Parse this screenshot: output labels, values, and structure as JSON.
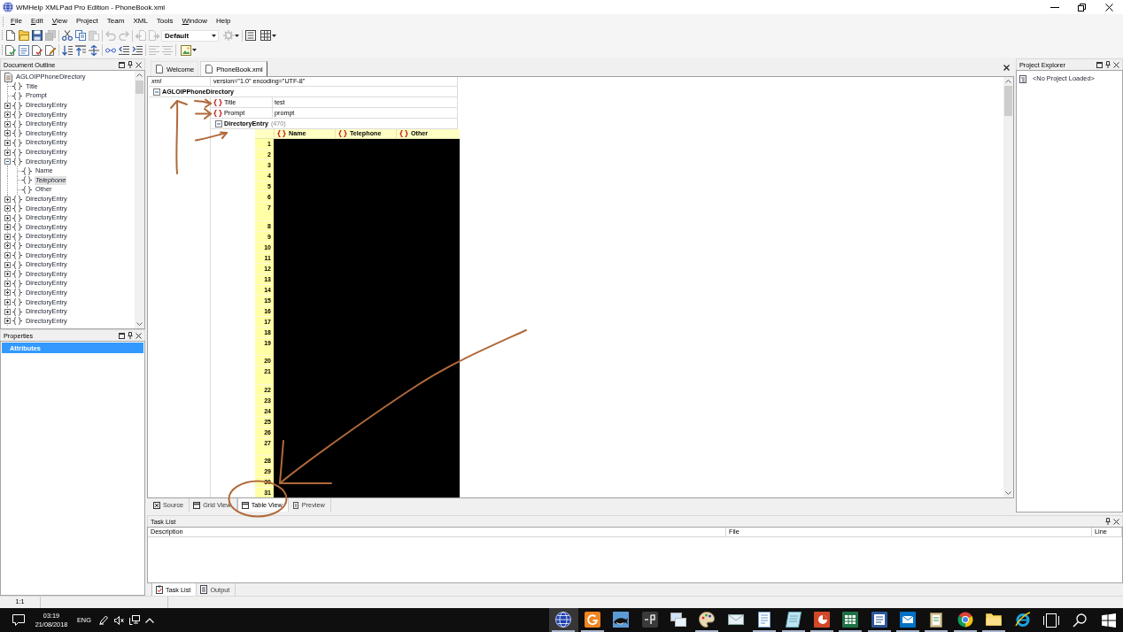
{
  "window": {
    "title": "WMHelp XMLPad Pro Edition - PhoneBook.xml"
  },
  "menu": [
    {
      "label": "File",
      "mnemonic": true
    },
    {
      "label": "Edit",
      "mnemonic": true
    },
    {
      "label": "View",
      "mnemonic": true
    },
    {
      "label": "Project",
      "mnemonic": false
    },
    {
      "label": "Team",
      "mnemonic": false
    },
    {
      "label": "XML",
      "mnemonic": false
    },
    {
      "label": "Tools",
      "mnemonic": false
    },
    {
      "label": "Window",
      "mnemonic": true
    },
    {
      "label": "Help",
      "mnemonic": false
    }
  ],
  "toolbars": [
    {
      "items": [
        {
          "kind": "button",
          "disabled": false
        },
        {
          "kind": "button",
          "disabled": false
        },
        {
          "kind": "button",
          "disabled": false
        },
        {
          "kind": "button",
          "disabled": true
        },
        {
          "kind": "separator"
        },
        {
          "kind": "button",
          "disabled": false
        },
        {
          "kind": "button",
          "disabled": false
        },
        {
          "kind": "button",
          "disabled": true
        },
        {
          "kind": "separator"
        },
        {
          "kind": "button",
          "disabled": true
        },
        {
          "kind": "button",
          "disabled": true
        },
        {
          "kind": "separator"
        },
        {
          "kind": "button",
          "disabled": true
        },
        {
          "kind": "button",
          "disabled": true
        },
        {
          "kind": "combo",
          "value": "Default"
        },
        {
          "kind": "button",
          "disabled": true,
          "dropdown": true
        },
        {
          "kind": "separator"
        },
        {
          "kind": "button",
          "disabled": false
        },
        {
          "kind": "button",
          "disabled": false,
          "dropdown": true
        }
      ]
    },
    {
      "items": [
        {
          "kind": "button",
          "disabled": false
        },
        {
          "kind": "button",
          "disabled": false
        },
        {
          "kind": "button",
          "disabled": false
        },
        {
          "kind": "button",
          "disabled": false
        },
        {
          "kind": "separator"
        },
        {
          "kind": "button",
          "disabled": false
        },
        {
          "kind": "button",
          "disabled": false
        },
        {
          "kind": "button",
          "disabled": false
        },
        {
          "kind": "separator"
        },
        {
          "kind": "button",
          "disabled": false
        },
        {
          "kind": "button",
          "disabled": false
        },
        {
          "kind": "button",
          "disabled": false
        },
        {
          "kind": "separator"
        },
        {
          "kind": "button",
          "disabled": true
        },
        {
          "kind": "button",
          "disabled": true
        },
        {
          "kind": "separator"
        },
        {
          "kind": "button",
          "disabled": false,
          "dropdown": true
        }
      ]
    }
  ],
  "document_outline": {
    "title": "Document Outline",
    "tree": [
      {
        "label": "AGLOIPPhoneDirectory",
        "kind": "document",
        "selected": false,
        "children": [
          {
            "label": "Title",
            "kind": "element",
            "selected": false
          },
          {
            "label": "Prompt",
            "kind": "element",
            "selected": false
          },
          {
            "label": "DirectoryEntry",
            "kind": "element",
            "expanded": false,
            "selected": false
          },
          {
            "label": "DirectoryEntry",
            "kind": "element",
            "expanded": false,
            "selected": false
          },
          {
            "label": "DirectoryEntry",
            "kind": "element",
            "expanded": false,
            "selected": false
          },
          {
            "label": "DirectoryEntry",
            "kind": "element",
            "expanded": false,
            "selected": false
          },
          {
            "label": "DirectoryEntry",
            "kind": "element",
            "expanded": false,
            "selected": false
          },
          {
            "label": "DirectoryEntry",
            "kind": "element",
            "expanded": false,
            "selected": false
          },
          {
            "label": "DirectoryEntry",
            "kind": "element",
            "expanded": true,
            "selected": false,
            "children": [
              {
                "label": "Name",
                "kind": "element",
                "selected": false
              },
              {
                "label": "Telephone",
                "kind": "element",
                "selected": true
              },
              {
                "label": "Other",
                "kind": "element",
                "selected": false
              }
            ]
          },
          {
            "label": "DirectoryEntry",
            "kind": "element",
            "expanded": false,
            "selected": false
          },
          {
            "label": "DirectoryEntry",
            "kind": "element",
            "expanded": false,
            "selected": false
          },
          {
            "label": "DirectoryEntry",
            "kind": "element",
            "expanded": false,
            "selected": false
          },
          {
            "label": "DirectoryEntry",
            "kind": "element",
            "expanded": false,
            "selected": false
          },
          {
            "label": "DirectoryEntry",
            "kind": "element",
            "expanded": false,
            "selected": false
          },
          {
            "label": "DirectoryEntry",
            "kind": "element",
            "expanded": false,
            "selected": false
          },
          {
            "label": "DirectoryEntry",
            "kind": "element",
            "expanded": false,
            "selected": false
          },
          {
            "label": "DirectoryEntry",
            "kind": "element",
            "expanded": false,
            "selected": false
          },
          {
            "label": "DirectoryEntry",
            "kind": "element",
            "expanded": false,
            "selected": false
          },
          {
            "label": "DirectoryEntry",
            "kind": "element",
            "expanded": false,
            "selected": false
          },
          {
            "label": "DirectoryEntry",
            "kind": "element",
            "expanded": false,
            "selected": false
          },
          {
            "label": "DirectoryEntry",
            "kind": "element",
            "expanded": false,
            "selected": false
          },
          {
            "label": "DirectoryEntry",
            "kind": "element",
            "expanded": false,
            "selected": false
          },
          {
            "label": "DirectoryEntry",
            "kind": "element",
            "expanded": false,
            "selected": false
          }
        ]
      }
    ]
  },
  "properties": {
    "title": "Properties",
    "items": [
      {
        "label": "Attributes",
        "selected": true
      }
    ]
  },
  "editor": {
    "tabs": [
      {
        "label": "Welcome",
        "selected": false
      },
      {
        "label": "PhoneBook.xml",
        "selected": true
      }
    ],
    "grid": {
      "declaration": {
        "name": "xml",
        "value": "version=\"1.0\" encoding=\"UTF-8\""
      },
      "root": {
        "name": "AGLOIPPhoneDirectory",
        "expanded": true,
        "fields": [
          {
            "name": "Title",
            "value": "test"
          },
          {
            "name": "Prompt",
            "value": "prompt"
          }
        ],
        "table": {
          "name": "DirectoryEntry",
          "count": "(470)",
          "expanded": true,
          "columns": [
            "Name",
            "Telephone",
            "Other"
          ],
          "rows": [
            {
              "number": "1",
              "multiline": false
            },
            {
              "number": "2",
              "multiline": false
            },
            {
              "number": "3",
              "multiline": false
            },
            {
              "number": "4",
              "multiline": false
            },
            {
              "number": "5",
              "multiline": false
            },
            {
              "number": "6",
              "multiline": false
            },
            {
              "number": "7",
              "multiline": true
            },
            {
              "number": "8",
              "multiline": false
            },
            {
              "number": "9",
              "multiline": false
            },
            {
              "number": "10",
              "multiline": false
            },
            {
              "number": "11",
              "multiline": false
            },
            {
              "number": "12",
              "multiline": false
            },
            {
              "number": "13",
              "multiline": false
            },
            {
              "number": "14",
              "multiline": false
            },
            {
              "number": "15",
              "multiline": false
            },
            {
              "number": "16",
              "multiline": false
            },
            {
              "number": "17",
              "multiline": false
            },
            {
              "number": "18",
              "multiline": false
            },
            {
              "number": "19",
              "multiline": true
            },
            {
              "number": "20",
              "multiline": false
            },
            {
              "number": "21",
              "multiline": true
            },
            {
              "number": "22",
              "multiline": false
            },
            {
              "number": "23",
              "multiline": false
            },
            {
              "number": "24",
              "multiline": false
            },
            {
              "number": "25",
              "multiline": false
            },
            {
              "number": "26",
              "multiline": false
            },
            {
              "number": "27",
              "multiline": true
            },
            {
              "number": "28",
              "multiline": false
            },
            {
              "number": "29",
              "multiline": false
            },
            {
              "number": "30",
              "multiline": false
            },
            {
              "number": "31",
              "multiline": false
            }
          ]
        }
      }
    },
    "view_tabs": [
      {
        "label": "Source",
        "selected": false
      },
      {
        "label": "Grid View",
        "selected": false
      },
      {
        "label": "Table View",
        "selected": true
      },
      {
        "label": "Preview",
        "selected": false
      }
    ]
  },
  "project_explorer": {
    "title": "Project Explorer",
    "items": [
      {
        "label": "<No Project Loaded>",
        "selected": false
      }
    ]
  },
  "task_list": {
    "title": "Task List",
    "columns": [
      "Description",
      "File",
      "Line"
    ],
    "tabs": [
      {
        "label": "Task List",
        "selected": true
      },
      {
        "label": "Output",
        "selected": false
      }
    ]
  },
  "status_bar": {
    "position": "1:1"
  },
  "taskbar": {
    "tray": {
      "time": "03:19",
      "date": "21/08/2018",
      "language": "ENG"
    },
    "apps": [
      {
        "selected": true,
        "running": true
      },
      {
        "selected": false,
        "running": true
      },
      {
        "selected": false,
        "running": false
      },
      {
        "selected": false,
        "running": false
      },
      {
        "selected": false,
        "running": false
      },
      {
        "selected": false,
        "running": true
      },
      {
        "selected": false,
        "running": false
      },
      {
        "selected": false,
        "running": true
      },
      {
        "selected": false,
        "running": true
      },
      {
        "selected": false,
        "running": true
      },
      {
        "selected": false,
        "running": true
      },
      {
        "selected": false,
        "running": true
      },
      {
        "selected": false,
        "running": true
      },
      {
        "selected": false,
        "running": true
      },
      {
        "selected": false,
        "running": true
      },
      {
        "selected": false,
        "running": true
      },
      {
        "selected": false,
        "running": false
      }
    ]
  },
  "annotations": [
    {
      "kind": "arrow"
    },
    {
      "kind": "arrow"
    },
    {
      "kind": "arrow"
    },
    {
      "kind": "arrow"
    },
    {
      "kind": "arrow"
    },
    {
      "kind": "circle"
    }
  ]
}
